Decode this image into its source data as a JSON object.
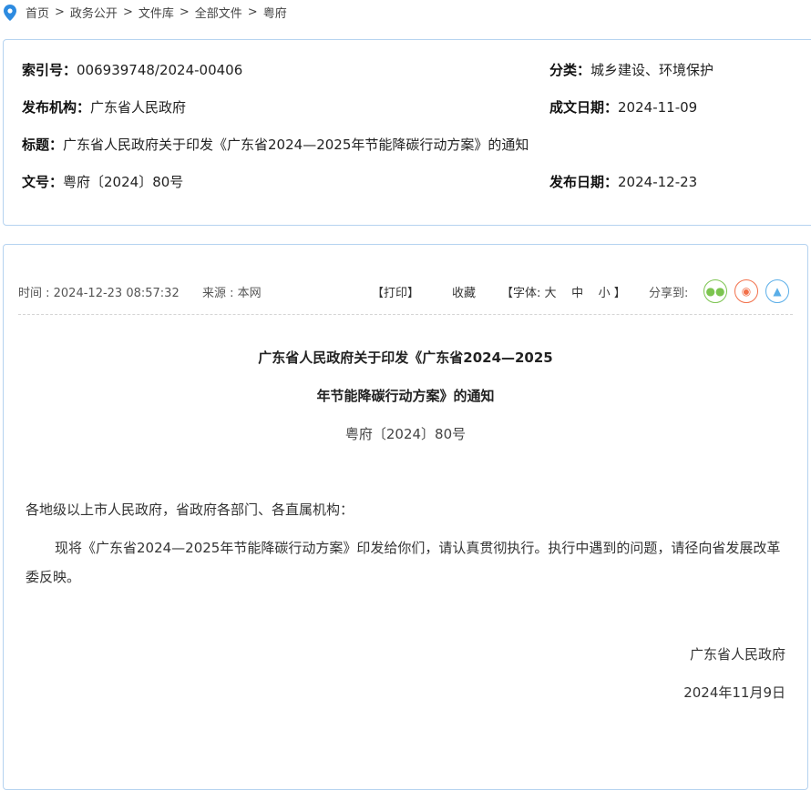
{
  "breadcrumb": [
    "首页",
    "政务公开",
    "文件库",
    "全部文件",
    "粤府"
  ],
  "breadcrumb_sep": ">",
  "info": {
    "index_label": "索引号：",
    "index_value": "006939748/2024-00406",
    "category_label": "分类：",
    "category_value": "城乡建设、环境保护",
    "publisher_label": "发布机构：",
    "publisher_value": "广东省人民政府",
    "written_date_label": "成文日期：",
    "written_date_value": "2024-11-09",
    "title_label": "标题：",
    "title_value": "广东省人民政府关于印发《广东省2024—2025年节能降碳行动方案》的通知",
    "docno_label": "文号：",
    "docno_value": "粤府〔2024〕80号",
    "publish_date_label": "发布日期：",
    "publish_date_value": "2024-12-23"
  },
  "toolbar": {
    "time": "时间 : 2024-12-23 08:57:32",
    "source": "来源 : 本网",
    "print": "【打印】",
    "favorite": "收藏",
    "font_label": "【字体:",
    "font_large": "大",
    "font_medium": "中",
    "font_small": "小",
    "font_close": "】",
    "share_label": "分享到:"
  },
  "article": {
    "title_line1": "广东省人民政府关于印发《广东省2024—2025",
    "title_line2": "年节能降碳行动方案》的通知",
    "doc_number": "粤府〔2024〕80号",
    "salutation": "各地级以上市人民政府，省政府各部门、各直属机构：",
    "body": "现将《广东省2024—2025年节能降碳行动方案》印发给你们，请认真贯彻执行。执行中遇到的问题，请径向省发展改革委反映。",
    "signature": "广东省人民政府",
    "date": "2024年11月9日"
  },
  "colors": {
    "wechat": "#7cc450",
    "weibo": "#f2704a",
    "qq": "#5aaee8",
    "border": "#b5d3f0"
  }
}
